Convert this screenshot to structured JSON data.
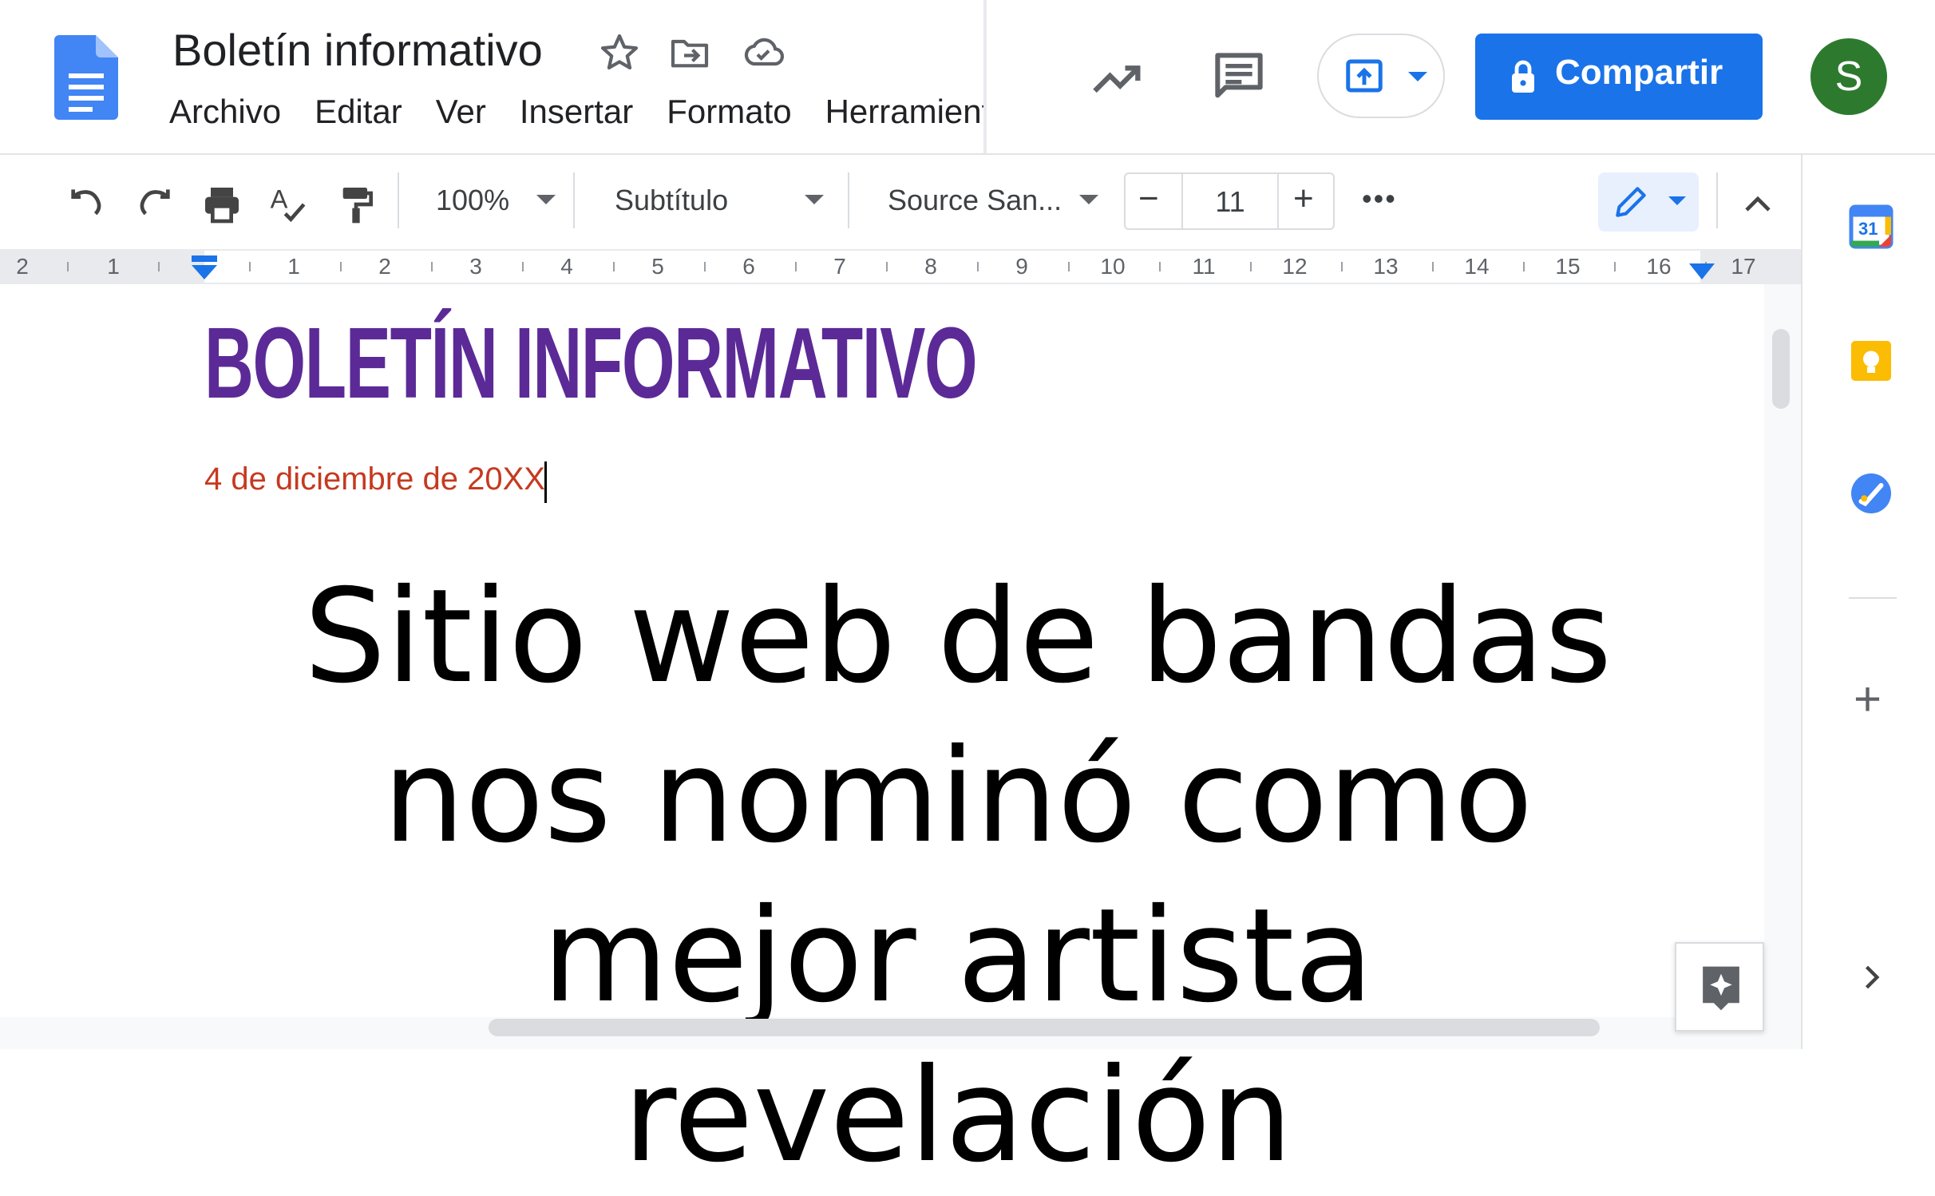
{
  "header": {
    "title": "Boletín informativo",
    "menu": [
      "Archivo",
      "Editar",
      "Ver",
      "Insertar",
      "Formato",
      "Herramientas"
    ],
    "share_label": "Compartir",
    "avatar_initial": "S",
    "brand_color": "#1a73e8"
  },
  "toolbar": {
    "zoom": "100%",
    "style": "Subtítulo",
    "font": "Source San...",
    "font_size": "11",
    "minus": "−",
    "plus": "+",
    "more": "•••"
  },
  "ruler": {
    "labels": [
      "2",
      "1",
      "1",
      "2",
      "3",
      "4",
      "5",
      "6",
      "7",
      "8",
      "9",
      "10",
      "11",
      "12",
      "13",
      "14",
      "15",
      "16",
      "17"
    ]
  },
  "document": {
    "title": "BOLETÍN INFORMATIVO",
    "date": "4 de diciembre de 20XX",
    "headline": "Sitio web de bandas nos nominó como mejor artista revelación",
    "title_color": "#5c2a97",
    "date_color": "#c53a1f"
  },
  "side_panel": {
    "calendar_day": "31",
    "add": "+"
  },
  "icons": [
    "docs-logo-icon",
    "star-icon",
    "move-folder-icon",
    "cloud-saved-icon",
    "activity-icon",
    "comments-icon",
    "present-icon",
    "lock-icon",
    "undo-icon",
    "redo-icon",
    "print-icon",
    "spellcheck-icon",
    "paint-format-icon",
    "pencil-icon",
    "collapse-icon",
    "calendar-icon",
    "keep-icon",
    "tasks-icon",
    "plus-icon",
    "chevron-right-icon",
    "explore-icon"
  ]
}
